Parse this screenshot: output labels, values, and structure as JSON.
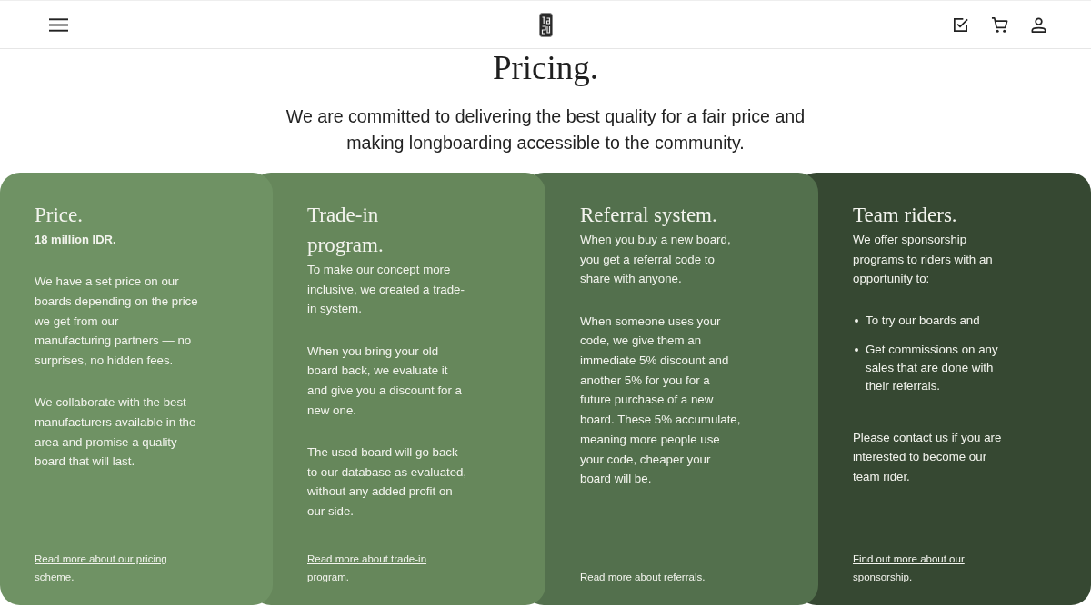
{
  "page": {
    "title": "Pricing.",
    "intro": "We are committed to delivering the best quality for a fair price and making longboarding accessible to the community."
  },
  "cards": [
    {
      "title": "Price.",
      "blocks": [
        {
          "kind": "lead",
          "text": "18 million IDR."
        },
        {
          "kind": "paragraph",
          "text": "We have a set price on our boards depending on the price we get from our manufacturing partners — no surprises, no hidden fees."
        },
        {
          "kind": "paragraph",
          "text": "We collaborate with the best manufacturers available in the area and promise a quality board that will last."
        }
      ],
      "link": "Read more about our pricing scheme."
    },
    {
      "title": "Trade-in program.",
      "blocks": [
        {
          "kind": "paragraph",
          "text": "To make our concept more inclusive, we created a trade-in system."
        },
        {
          "kind": "paragraph",
          "text": "When you bring your old board back, we evaluate it and give you a discount for a new one."
        },
        {
          "kind": "paragraph",
          "text": "The used board will go back to our database as evaluated, without any added profit on our side."
        }
      ],
      "link": "Read more about trade-in program."
    },
    {
      "title": "Referral system.",
      "blocks": [
        {
          "kind": "paragraph",
          "text": "When you buy a new board, you get a referral code to share with anyone."
        },
        {
          "kind": "paragraph",
          "text": "When someone uses your code, we give them an immediate 5% discount and another 5% for you for a future purchase of a new board. These 5% accumulate, meaning more people use your code, cheaper your board will be."
        }
      ],
      "link": "Read more about referrals."
    },
    {
      "title": "Team riders.",
      "blocks": [
        {
          "kind": "paragraph",
          "text": "We offer sponsorship programs to riders with an opportunity to:"
        },
        {
          "kind": "list",
          "items": [
            "To try our boards and",
            "Get commissions on any sales that are done with their referrals."
          ]
        },
        {
          "kind": "paragraph",
          "text": "Please contact us if you are interested to become our team rider."
        }
      ],
      "link": "Find out more about our sponsorship."
    }
  ]
}
